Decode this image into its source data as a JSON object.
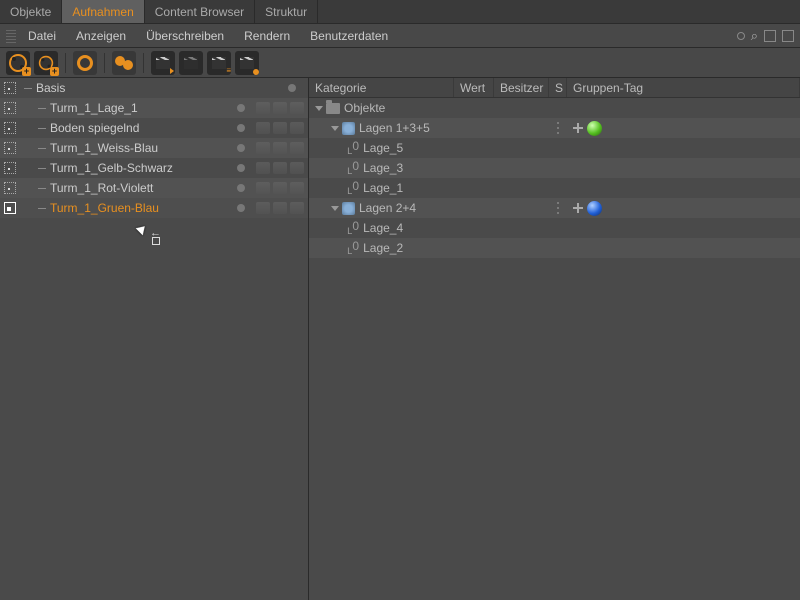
{
  "tabs": [
    "Objekte",
    "Aufnahmen",
    "Content Browser",
    "Struktur"
  ],
  "active_tab": 1,
  "menu": [
    "Datei",
    "Anzeigen",
    "Überschreiben",
    "Rendern",
    "Benutzerdaten"
  ],
  "left_tree": {
    "root": "Basis",
    "items": [
      "Turm_1_Lage_1",
      "Boden spiegelnd",
      "Turm_1_Weiss-Blau",
      "Turm_1_Gelb-Schwarz",
      "Turm_1_Rot-Violett",
      "Turm_1_Gruen-Blau"
    ],
    "selected": 5
  },
  "columns": {
    "kategorie": "Kategorie",
    "wert": "Wert",
    "besitzer": "Besitzer",
    "s": "S",
    "tag": "Gruppen-Tag"
  },
  "right_tree": [
    {
      "type": "root",
      "label": "Objekte",
      "depth": 0
    },
    {
      "type": "group",
      "label": "Lagen 1+3+5",
      "depth": 1,
      "has_tag": true,
      "tag_color": "green"
    },
    {
      "type": "leaf",
      "label": "Lage_5",
      "depth": 2
    },
    {
      "type": "leaf",
      "label": "Lage_3",
      "depth": 2
    },
    {
      "type": "leaf",
      "label": "Lage_1",
      "depth": 2
    },
    {
      "type": "group",
      "label": "Lagen 2+4",
      "depth": 1,
      "has_tag": true,
      "tag_color": "blue"
    },
    {
      "type": "leaf",
      "label": "Lage_4",
      "depth": 2
    },
    {
      "type": "leaf",
      "label": "Lage_2",
      "depth": 2
    }
  ]
}
